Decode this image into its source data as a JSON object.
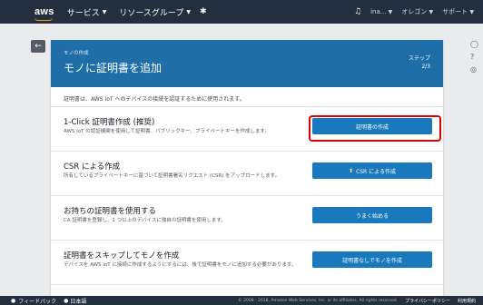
{
  "nav": {
    "logo": "aws",
    "services": "サービス",
    "resource_groups": "リソースグループ",
    "pin_icon": "pin-icon",
    "bell_icon": "bell-icon",
    "user": "ina...",
    "region": "オレゴン",
    "support": "サポート"
  },
  "page": {
    "breadcrumb": "モノの作成",
    "title": "モノに証明書を追加",
    "step_label": "ステップ",
    "step_value": "2/3",
    "intro": "証明書は、AWS IoT へのデバイスの接続を認証するために使用されます。"
  },
  "options": [
    {
      "title": "1-Click 証明書作成 (推奨)",
      "desc": "AWS IoT の認証機関を使用して証明書、パブリックキー、プライベートキーを作成します。",
      "button": "証明書の作成"
    },
    {
      "title": "CSR による作成",
      "desc": "所有しているプライベートキーに基づいて証明書署名リクエスト (CSR) をアップロードします。",
      "button": "CSR による作成"
    },
    {
      "title": "お持ちの証明書を使用する",
      "desc": "CA 証明書を登録し、1 つ以上のデバイスに独自の証明書を使用します。",
      "button": "うまく始める"
    },
    {
      "title": "証明書をスキップしてモノを作成",
      "desc": "デバイスを AWS IoT に接続に作成するようにするには、後で証明書をモノに追加する必要があります。",
      "button": "証明書なしでモノを作成"
    }
  ],
  "footer": {
    "feedback": "フィードバック",
    "language": "日本語",
    "copyright": "© 2008 - 2018, Amazon Web Services, Inc. or its affiliates. All rights reserved.",
    "privacy": "プライバシーポリシー",
    "terms": "利用規約"
  }
}
